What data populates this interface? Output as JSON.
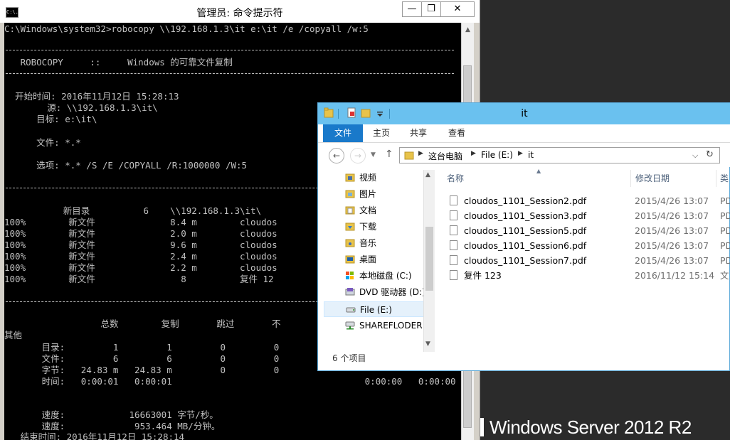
{
  "branding": "Windows Server 2012 R2",
  "cmd": {
    "icon_text": "C:\\.",
    "title": "管理员: 命令提示符",
    "min": "—",
    "max": "❐",
    "close": "✕",
    "lines": [
      "C:\\Windows\\system32>robocopy \\\\192.168.1.3\\it e:\\it /e /copyall /w:5",
      "   ROBOCOPY     ::     Windows 的可靠文件复制",
      "  开始时间: 2016年11月12日 15:28:13",
      "        源: \\\\192.168.1.3\\it\\",
      "      目标: e:\\it\\",
      "      文件: *.*",
      "      选项: *.* /S /E /COPYALL /R:1000000 /W:5",
      "           新目录          6    \\\\192.168.1.3\\it\\",
      "100%        新文件              8.4 m        cloudos",
      "100%        新文件              2.0 m        cloudos",
      "100%        新文件              9.6 m        cloudos",
      "100%        新文件              2.4 m        cloudos",
      "100%        新文件              2.2 m        cloudos",
      "100%        新文件                8          复件 12",
      "                  总数        复制       跳过       不",
      "其他",
      "       目录:         1         1         0         0",
      "       文件:         6         6         0         0",
      "       字节:   24.83 m   24.83 m         0         0",
      "       时间:   0:00:01   0:00:01                                    0:00:00   0:00:00",
      "       速度:            16663001 字节/秒。",
      "       速度:             953.464 MB/分钟。",
      "   结束时间: 2016年11月12日 15:28:14"
    ]
  },
  "explorer": {
    "title": "it",
    "tabs": [
      "文件",
      "主页",
      "共享",
      "查看"
    ],
    "breadcrumb": [
      "这台电脑",
      "File (E:)",
      "it"
    ],
    "nav_items": [
      {
        "label": "视频",
        "icon": "videos-folder-icon"
      },
      {
        "label": "图片",
        "icon": "pictures-folder-icon"
      },
      {
        "label": "文档",
        "icon": "documents-folder-icon"
      },
      {
        "label": "下载",
        "icon": "downloads-folder-icon"
      },
      {
        "label": "音乐",
        "icon": "music-folder-icon"
      },
      {
        "label": "桌面",
        "icon": "desktop-folder-icon"
      },
      {
        "label": "本地磁盘 (C:)",
        "icon": "local-disk-icon"
      },
      {
        "label": "DVD 驱动器 (D:)",
        "icon": "dvd-drive-icon"
      },
      {
        "label": "File (E:)",
        "icon": "drive-icon"
      },
      {
        "label": "SHAREFLODER",
        "icon": "network-drive-icon"
      }
    ],
    "columns": [
      "名称",
      "修改日期",
      "类"
    ],
    "files": [
      {
        "name": "cloudos_1101_Session2.pdf",
        "date": "2015/4/26 13:07",
        "type": "PD"
      },
      {
        "name": "cloudos_1101_Session3.pdf",
        "date": "2015/4/26 13:07",
        "type": "PD"
      },
      {
        "name": "cloudos_1101_Session5.pdf",
        "date": "2015/4/26 13:07",
        "type": "PD"
      },
      {
        "name": "cloudos_1101_Session6.pdf",
        "date": "2015/4/26 13:07",
        "type": "PD"
      },
      {
        "name": "cloudos_1101_Session7.pdf",
        "date": "2015/4/26 13:07",
        "type": "PD"
      },
      {
        "name": "复件 123",
        "date": "2016/11/12 15:14",
        "type": "文"
      }
    ],
    "status": "6 个项目"
  }
}
